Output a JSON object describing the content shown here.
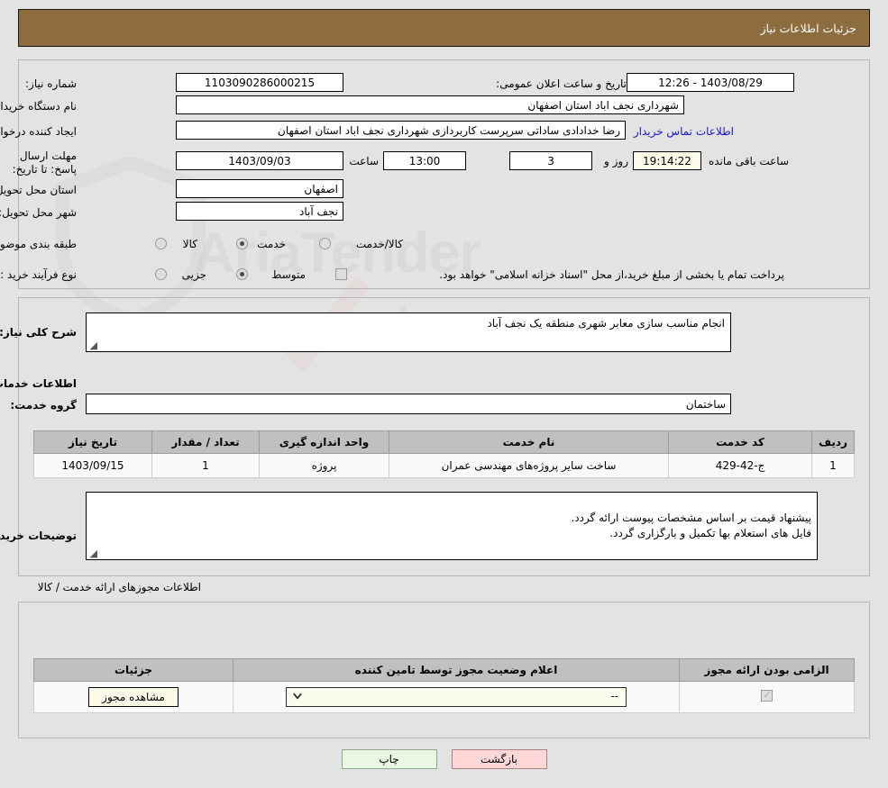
{
  "header": {
    "title": "جزئیات اطلاعات نیاز"
  },
  "watermark": {
    "brand": "AriaTender",
    "tld": ".net"
  },
  "top": {
    "need_number_label": "شماره نیاز:",
    "need_number_value": "1103090286000215",
    "announce_label": "تاریخ و ساعت اعلان عمومی:",
    "announce_value": "1403/08/29 - 12:26",
    "buyer_org_label": "نام دستگاه خریدار:",
    "buyer_org_value": "شهرداری نجف اباد استان اصفهان",
    "creator_label": "ایجاد کننده درخواست:",
    "creator_value": "رضا خدادادی ساداتی سرپرست  کاربردازی شهرداری نجف اباد استان اصفهان",
    "contact_link": "اطلاعات تماس خریدار",
    "deadline_label": "مهلت ارسال پاسخ: تا تاریخ:",
    "deadline_date": "1403/09/03",
    "hour_label": "ساعت",
    "hour_value": "13:00",
    "days_value": "3",
    "days_text": "روز و",
    "remaining_time": "19:14:22",
    "remaining_text": "ساعت باقی مانده",
    "province_label": "استان محل تحویل:",
    "province_value": "اصفهان",
    "city_label": "شهر محل تحویل:",
    "city_value": "نجف آباد",
    "category_label": "طبقه بندی موضوعی:",
    "category_options": [
      {
        "label": "کالا",
        "selected": false
      },
      {
        "label": "خدمت",
        "selected": true
      },
      {
        "label": "کالا/خدمت",
        "selected": false
      }
    ],
    "process_label": "نوع فرآیند خرید :",
    "process_options": [
      {
        "label": "جزیی",
        "selected": false
      },
      {
        "label": "متوسط",
        "selected": true
      }
    ],
    "treasury_checked": false,
    "treasury_text": "پرداخت تمام یا بخشی از مبلغ خرید،از محل \"اسناد خزانه اسلامی\" خواهد بود."
  },
  "mid": {
    "need_desc_label": "شرح کلی نیاز:",
    "need_desc_value": "انجام مناسب سازی معابر شهری منطقه یک نجف آباد",
    "services_heading": "اطلاعات خدمات مورد نیاز",
    "service_group_label": "گروه خدمت:",
    "service_group_value": "ساختمان",
    "table_headers": [
      "ردیف",
      "کد خدمت",
      "نام خدمت",
      "واحد اندازه گیری",
      "تعداد / مقدار",
      "تاریخ نیاز"
    ],
    "table_rows": [
      {
        "row": "1",
        "code": "ج-42-429",
        "name": "ساخت سایر پروژه‌های مهندسی عمران",
        "unit": "پروژه",
        "qty": "1",
        "date": "1403/09/15"
      }
    ],
    "buyer_notes_label": "توضیحات خریدار:",
    "buyer_notes_value": "پیشنهاد قیمت بر اساس مشخصات پیوست ارائه گردد.\nفایل های استعلام بها تکمیل و بارگزاری گردد."
  },
  "permits": {
    "section_title": "اطلاعات مجوزهای ارائه خدمت / کالا",
    "table_headers": [
      "الزامی بودن ارائه مجوز",
      "اعلام وضعیت مجوز توسط تامین کننده",
      "جزئیات"
    ],
    "row": {
      "required_checked": true,
      "status_value": "--",
      "status_icon": "chevron-down-icon",
      "details_button": "مشاهده مجوز"
    }
  },
  "footer": {
    "back_button": "بازگشت",
    "print_button": "چاپ"
  }
}
